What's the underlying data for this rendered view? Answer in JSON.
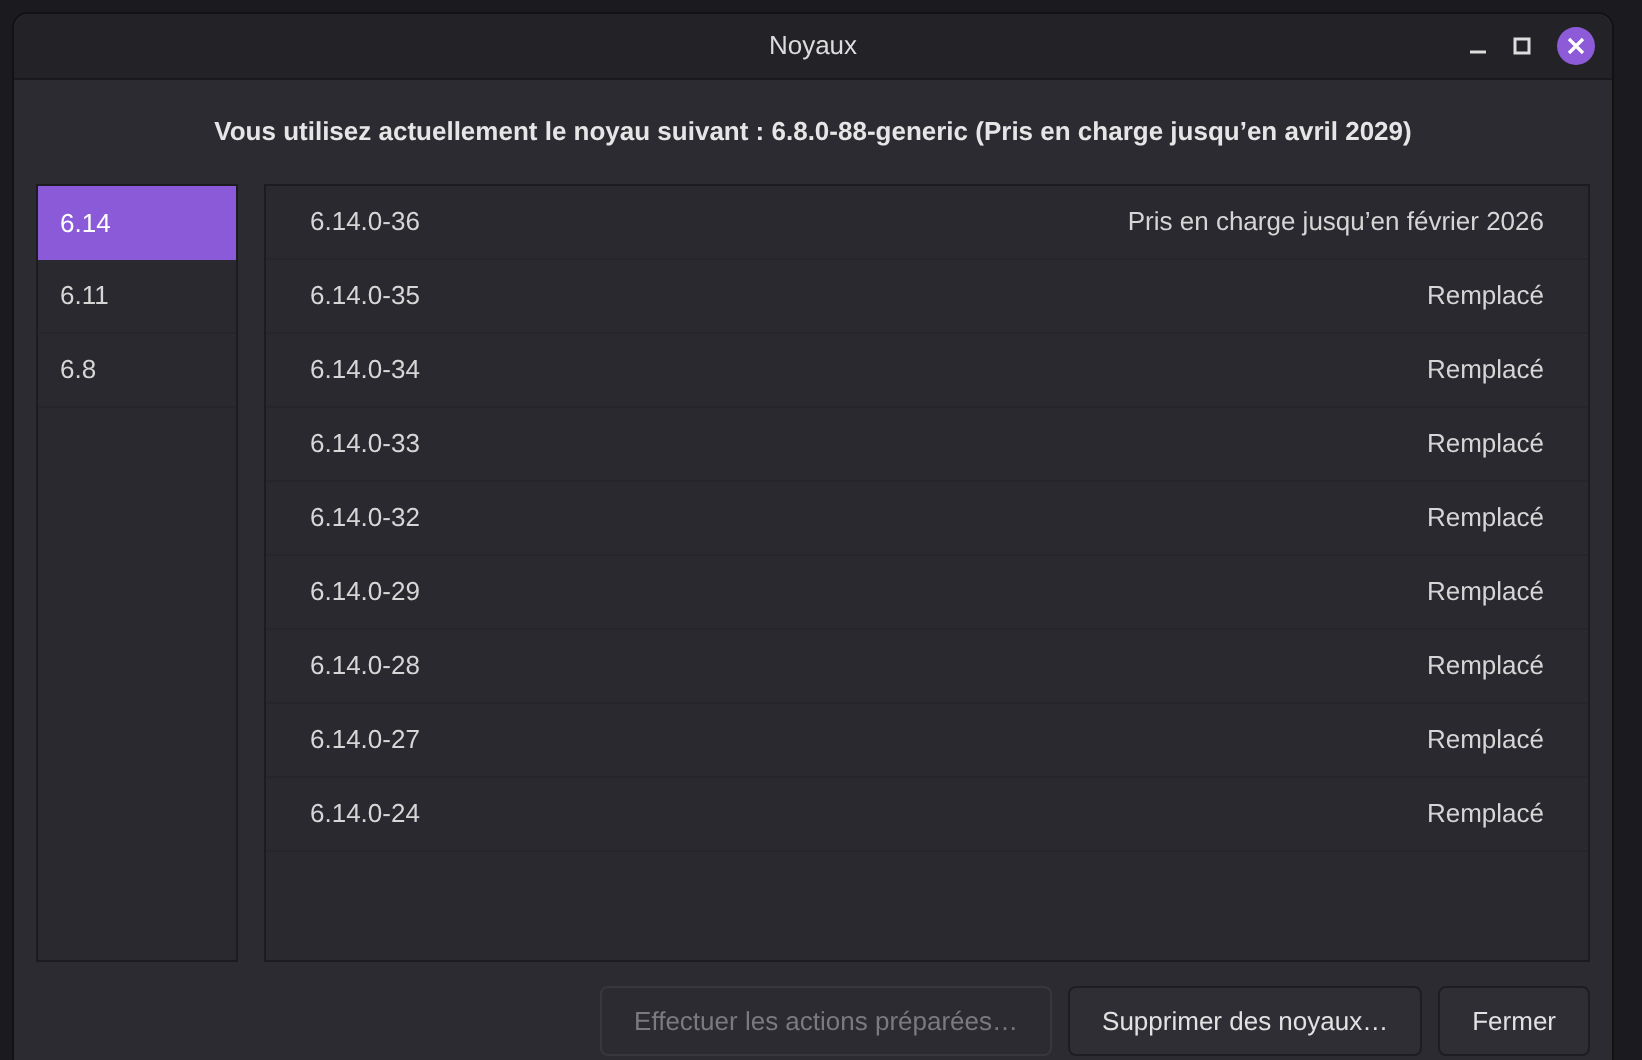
{
  "window": {
    "title": "Noyaux"
  },
  "header": "Vous utilisez actuellement le noyau suivant : 6.8.0-88-generic (Pris en charge jusqu’en avril 2029)",
  "sidebar": {
    "items": [
      {
        "label": "6.14",
        "selected": true
      },
      {
        "label": "6.11",
        "selected": false
      },
      {
        "label": "6.8",
        "selected": false
      }
    ]
  },
  "kernels": [
    {
      "version": "6.14.0-36",
      "status": "Pris en charge jusqu’en février 2026"
    },
    {
      "version": "6.14.0-35",
      "status": "Remplacé"
    },
    {
      "version": "6.14.0-34",
      "status": "Remplacé"
    },
    {
      "version": "6.14.0-33",
      "status": "Remplacé"
    },
    {
      "version": "6.14.0-32",
      "status": "Remplacé"
    },
    {
      "version": "6.14.0-29",
      "status": "Remplacé"
    },
    {
      "version": "6.14.0-28",
      "status": "Remplacé"
    },
    {
      "version": "6.14.0-27",
      "status": "Remplacé"
    },
    {
      "version": "6.14.0-24",
      "status": "Remplacé"
    }
  ],
  "buttons": [
    {
      "label": "Effectuer les actions préparées…",
      "disabled": true
    },
    {
      "label": "Supprimer des noyaux…",
      "disabled": false
    },
    {
      "label": "Fermer",
      "disabled": false
    }
  ]
}
